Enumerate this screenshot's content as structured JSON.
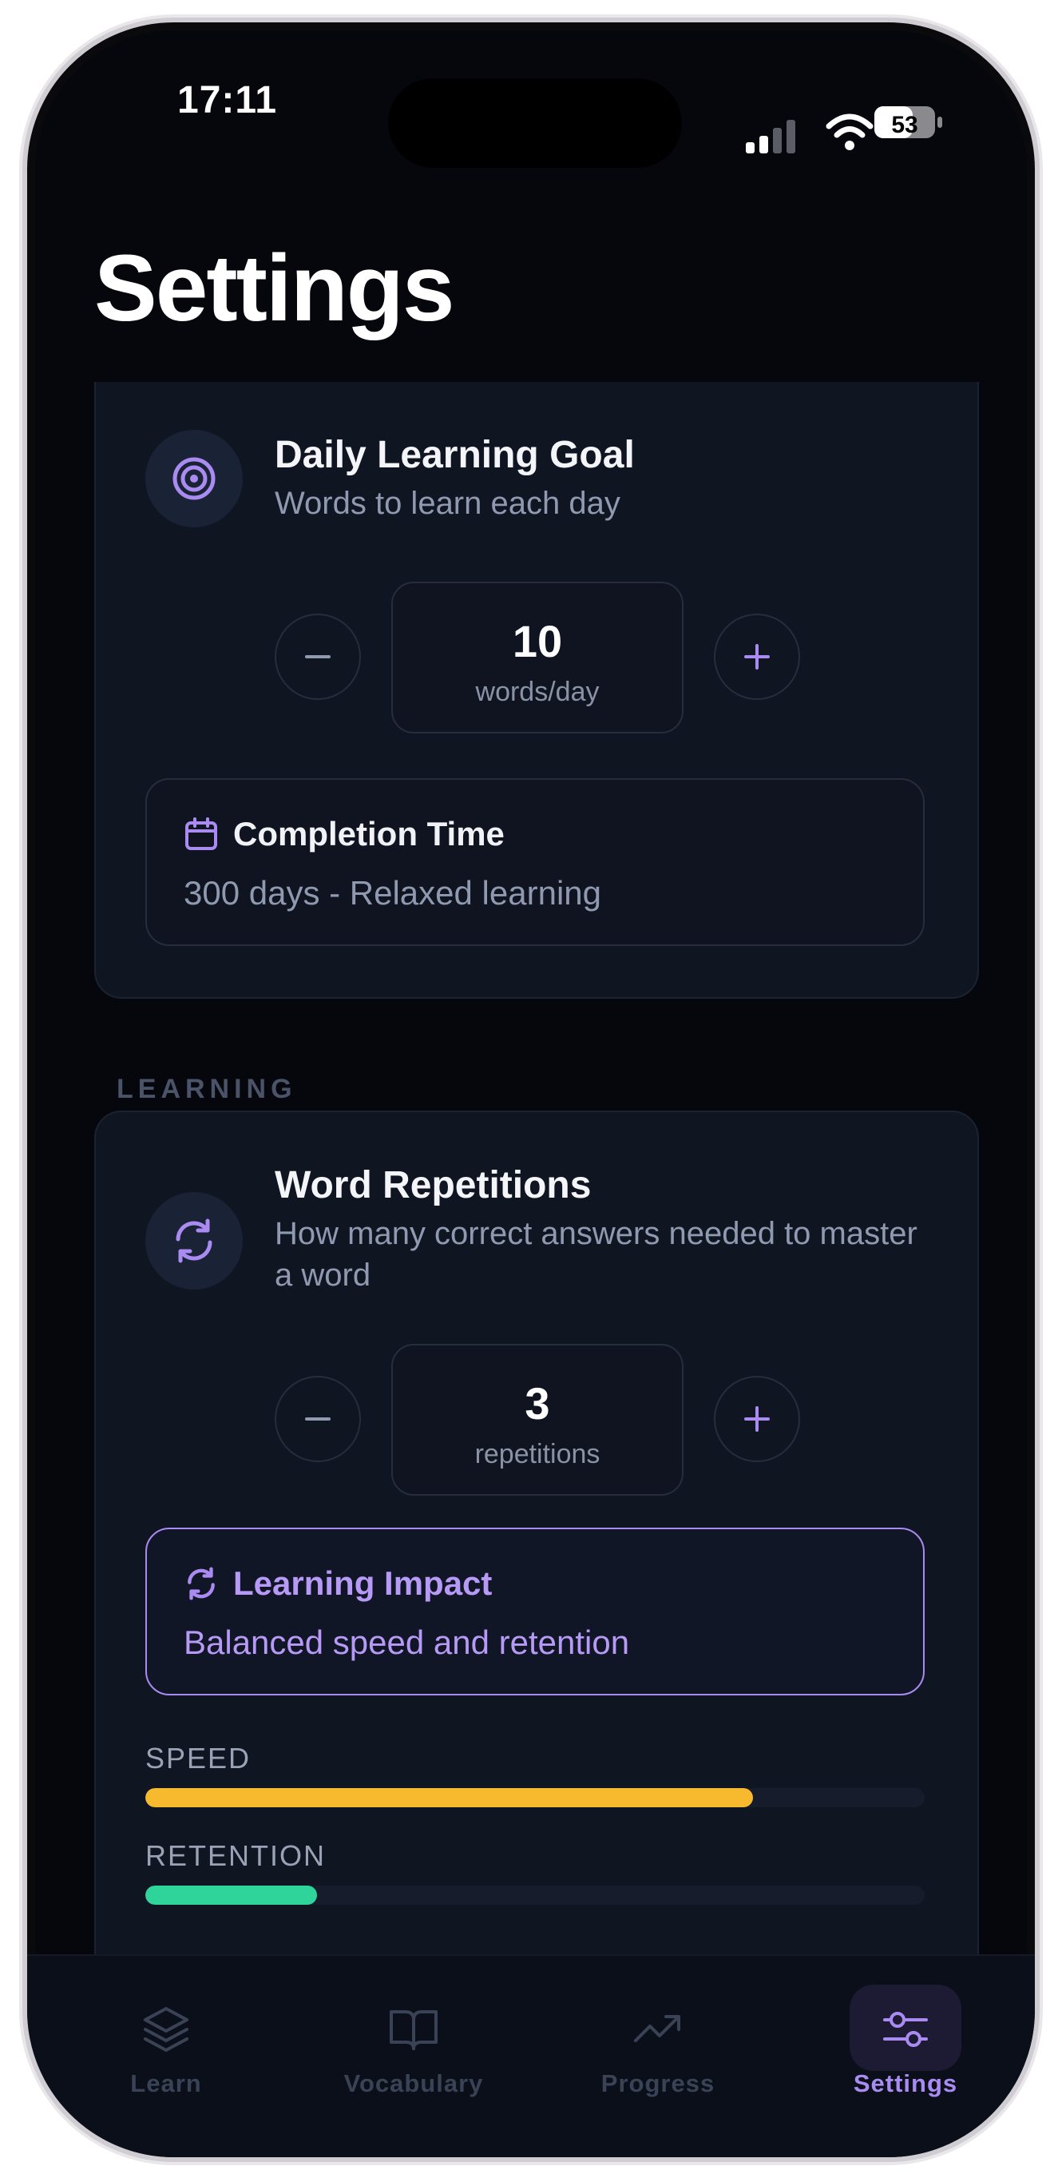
{
  "status": {
    "time": "17:11",
    "battery": "53"
  },
  "page": {
    "title": "Settings"
  },
  "goal": {
    "title": "Daily Learning Goal",
    "subtitle": "Words to learn each day",
    "value": "10",
    "unit": "words/day",
    "completion_title": "Completion Time",
    "completion_text": "300 days - Relaxed learning"
  },
  "learning": {
    "section_label": "LEARNING",
    "title": "Word Repetitions",
    "subtitle": "How many correct answers needed to master a word",
    "value": "3",
    "unit": "repetitions",
    "impact_title": "Learning Impact",
    "impact_text": "Balanced speed and retention",
    "speed_label": "SPEED",
    "speed_percent": 78,
    "retention_label": "RETENTION",
    "retention_percent": 22
  },
  "colors": {
    "accent": "#a98bf1",
    "speed": "#f7b92e",
    "retention": "#2fd49b"
  },
  "tabs": [
    {
      "label": "Learn",
      "icon": "layers-icon"
    },
    {
      "label": "Vocabulary",
      "icon": "book-icon"
    },
    {
      "label": "Progress",
      "icon": "trending-up-icon"
    },
    {
      "label": "Settings",
      "icon": "sliders-icon",
      "active": true
    }
  ]
}
